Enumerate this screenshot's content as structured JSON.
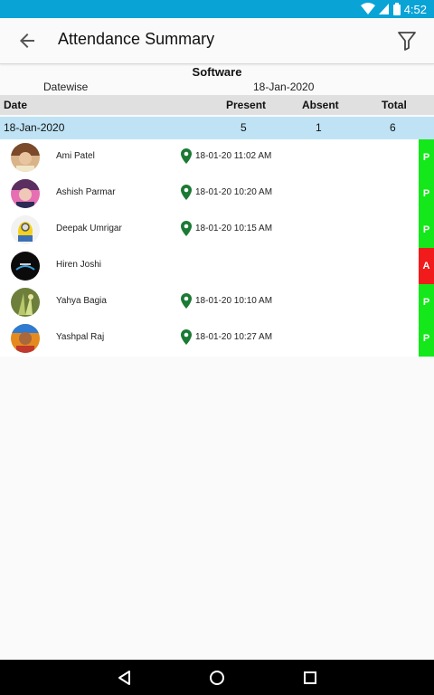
{
  "status_bar": {
    "time": "4:52",
    "icons": [
      "wifi-icon",
      "signal-icon",
      "battery-icon"
    ]
  },
  "app_bar": {
    "title": "Attendance Summary",
    "back_icon": "back-arrow-icon",
    "filter_icon": "filter-icon"
  },
  "section": {
    "name": "Software",
    "mode": "Datewise",
    "date": "18-Jan-2020"
  },
  "table_header": {
    "date": "Date",
    "present": "Present",
    "absent": "Absent",
    "total": "Total"
  },
  "summary": {
    "date": "18-Jan-2020",
    "present": "5",
    "absent": "1",
    "total": "6"
  },
  "employees": [
    {
      "name": "Ami Patel",
      "time": "18-01-20 11:02 AM",
      "status": "P"
    },
    {
      "name": "Ashish Parmar",
      "time": "18-01-20 10:20 AM",
      "status": "P"
    },
    {
      "name": "Deepak Umrigar",
      "time": "18-01-20 10:15 AM",
      "status": "P"
    },
    {
      "name": "Hiren Joshi",
      "time": "",
      "status": "A"
    },
    {
      "name": "Yahya Bagia",
      "time": "18-01-20 10:10 AM",
      "status": "P"
    },
    {
      "name": "Yashpal Raj",
      "time": "18-01-20 10:27 AM",
      "status": "P"
    }
  ],
  "colors": {
    "status_bar": "#0aa3d6",
    "present": "#14e81a",
    "absent": "#f11b1b",
    "summary_row": "#bfe3f5",
    "header_row": "#e0e0e0",
    "pin": "#1b7a34"
  },
  "nav_bar": {
    "icons": [
      "back-triangle-icon",
      "home-circle-icon",
      "recents-square-icon"
    ]
  }
}
